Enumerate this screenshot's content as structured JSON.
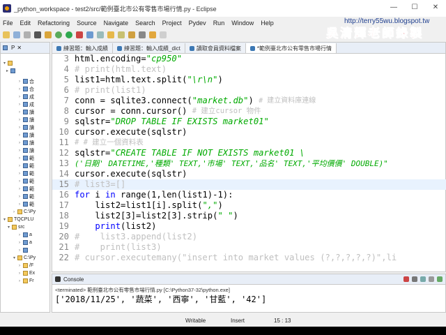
{
  "window": {
    "title": "_python_workspace - test2/src/範例臺北市公有零售市場行情.py - Eclipse",
    "min": "—",
    "max": "☐",
    "close": "✕"
  },
  "watermark": {
    "url": "http://terry55wu.blogspot.tw",
    "name": "吳清輝老師錄製"
  },
  "menu": [
    "File",
    "Edit",
    "Refactoring",
    "Source",
    "Navigate",
    "Search",
    "Project",
    "Pydev",
    "Run",
    "Window",
    "Help"
  ],
  "left_panel": {
    "title": "P",
    "items_a": [
      "合",
      "合",
      "成",
      "成",
      "讀",
      "讀",
      "讀",
      "讀",
      "讀",
      "讀",
      "範",
      "範",
      "範",
      "範",
      "範",
      "範",
      "範"
    ],
    "python_1": "C:\\Py",
    "project": "TQCPLU",
    "src": "src",
    "sub1": "a",
    "sub2": "a",
    "python_2": "C:\\Py",
    "lib1": "/F",
    "lib2": "Ex",
    "lib3": "Fr"
  },
  "tabs": [
    {
      "label": "練習題：輸入成績"
    },
    {
      "label": "練習題：輸入成績_dict"
    },
    {
      "label": "讀取會員資料檔案"
    },
    {
      "label": "*範例臺北市公有零售市場行情"
    }
  ],
  "code": {
    "l3": "3",
    "l4": "4",
    "l5": "5",
    "l6": "6",
    "l7": "7",
    "l8": "8",
    "l9": "9",
    "l10": "10",
    "l11": "11",
    "l12": "12",
    "l13": "13",
    "l14": "14",
    "l15": "15",
    "l16": "16",
    "l17": "17",
    "l18": "18",
    "l19": "19",
    "l20": "20",
    "l21": "21",
    "l22": "22",
    "c3a": "html.encoding=",
    "c3b": "\"cp950\"",
    "c4": "# print(html.text)",
    "c5a": "list1=html.text.split(",
    "c5b": "\"\\r\\n\"",
    "c5c": ")",
    "c6": "# print(list1)",
    "c7a": "conn = sqlite3.connect(",
    "c7b": "\"market.db\"",
    "c7c": ") ",
    "c7d": "# 建立資料庫連線",
    "c8a": "cursor = conn.cursor() ",
    "c8b": "# 建立cursor 物件",
    "c9a": "sqlstr=",
    "c9b": "\"DROP TABLE IF EXISTS market01\"",
    "c10": "cursor.execute(sqlstr)",
    "c11": "# # 建立一個資料表",
    "c12a": "sqlstr=",
    "c12b": "\"CREATE TABLE IF NOT EXISTS market01 \\",
    "c13": "('日期' DATETIME,'種類' TEXT,'市場' TEXT,'品名' TEXT,'平均價價' DOUBLE)\"",
    "c14": "cursor.execute(sqlstr)",
    "c15": "# list3=[]",
    "c16a": "for",
    "c16b": " i ",
    "c16c": "in",
    "c16d": " range(1,len(list1)-1):",
    "c17a": "    list2=list1[i].split(",
    "c17b": "\",\"",
    "c17c": ")",
    "c18a": "    list2[3]=list2[3].strip(",
    "c18b": "\" \"",
    "c18c": ")",
    "c19a": "    ",
    "c19b": "print",
    "c19c": "(list2)",
    "c20": "#    list3.append(list2)",
    "c21": "#    print(list3)",
    "c22": "# cursor.executemany(\"insert into market values (?,?,?,?,?)\",li"
  },
  "console": {
    "title": "Console",
    "path": "<terminated> 範例臺北市公有零售市場行情.py [C:\\Python37-32\\python.exe]",
    "output": "['2018/11/25', '蔬菜', '西寧', '甘藍', '42']"
  },
  "status": {
    "mode": "Writable",
    "insert": "Insert",
    "pos": "15 : 13"
  }
}
